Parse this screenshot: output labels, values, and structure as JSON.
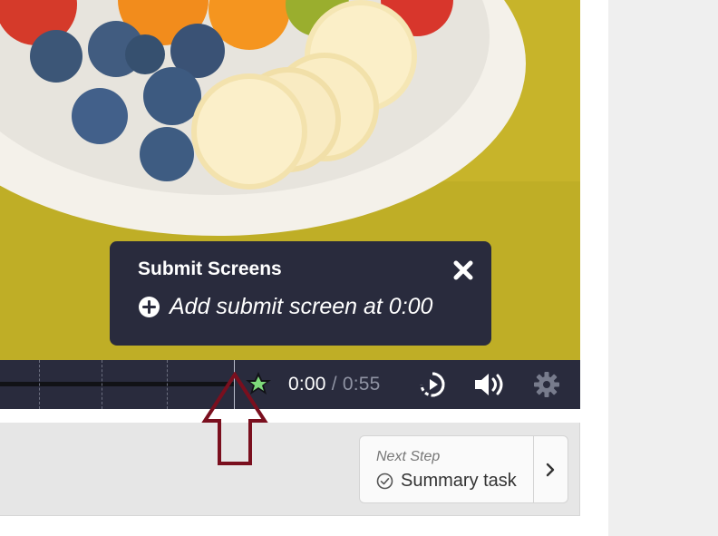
{
  "video": {
    "current_time": "0:00",
    "separator": "/",
    "duration": "0:55"
  },
  "tooltip": {
    "title": "Submit Screens",
    "add_label": "Add submit screen at 0:00"
  },
  "next_step": {
    "label": "Next Step",
    "task_name": "Summary task"
  },
  "colors": {
    "control_bg": "#292b3d",
    "marker_green": "#7ed97a",
    "arrow_red": "#7a0f1e",
    "video_bg": "#c8b52a"
  },
  "icons": [
    "close-icon",
    "plus-circle-icon",
    "star-marker-icon",
    "replay-icon",
    "volume-icon",
    "gear-icon",
    "check-circle-icon",
    "chevron-right-icon",
    "up-arrow-annotation"
  ]
}
